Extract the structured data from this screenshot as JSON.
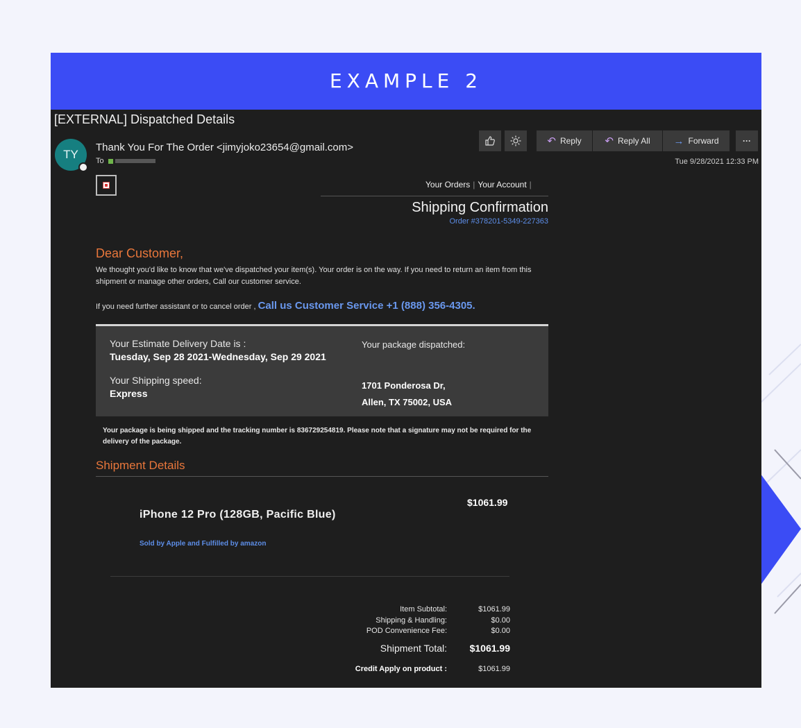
{
  "banner": {
    "title": "EXAMPLE 2"
  },
  "email": {
    "subject": "[EXTERNAL] Dispatched Details",
    "avatar_initials": "TY",
    "sender": "Thank You For The Order <jimyjoko23654@gmail.com>",
    "to_label": "To",
    "date": "Tue 9/28/2021 12:33 PM",
    "toolbar": {
      "like_icon": "thumbs-up-icon",
      "sun_icon": "sun-icon",
      "reply": "Reply",
      "reply_all": "Reply All",
      "forward": "Forward",
      "more": "···"
    }
  },
  "message": {
    "links": {
      "orders": "Your Orders",
      "account": "Your Account"
    },
    "heading": "Shipping Confirmation",
    "order_number": "Order #378201-5349-227363",
    "greeting": "Dear Customer,",
    "paragraph": "We thought you'd like to know that we've dispatched your item(s). Your order is on the way. If you need to return an item from this shipment or manage other orders, Call our customer service.",
    "assist_text": "If you need further assistant or to cancel order ,",
    "call_text": "Call us Customer Service +1 (888) 356-4305.",
    "delivery_label": "Your Estimate Delivery Date is :",
    "delivery_value": "Tuesday, Sep 28 2021-Wednesday, Sep 29 2021",
    "speed_label": "Your Shipping speed:",
    "speed_value": "Express",
    "dispatched_label": "Your package dispatched:",
    "address_line1": "1701 Ponderosa Dr,",
    "address_line2": "Allen, TX 75002, USA",
    "tracking_text": "Your package is being shipped and the tracking number is 836729254819. Please note that a signature may not be required for the delivery of the package.",
    "shipment_details": "Shipment Details",
    "product_name": "iPhone 12 Pro (128GB, Pacific Blue)",
    "product_price": "$1061.99",
    "sold_by": "Sold by Apple and Fulfilled by amazon",
    "totals": {
      "subtotal_label": "Item Subtotal:",
      "subtotal_value": "$1061.99",
      "shipping_label": "Shipping & Handling:",
      "shipping_value": "$0.00",
      "pod_label": "POD Convenience Fee:",
      "pod_value": "$0.00",
      "shipment_total_label": "Shipment Total:",
      "shipment_total_value": "$1061.99",
      "credit_label": "Credit Apply on product :",
      "credit_value": "$1061.99"
    }
  },
  "colors": {
    "background": "#f3f4fc",
    "banner": "#3b4cf5",
    "email_bg": "#1e1e1e",
    "accent_orange": "#e9773b",
    "link_blue": "#5d8ee8"
  }
}
